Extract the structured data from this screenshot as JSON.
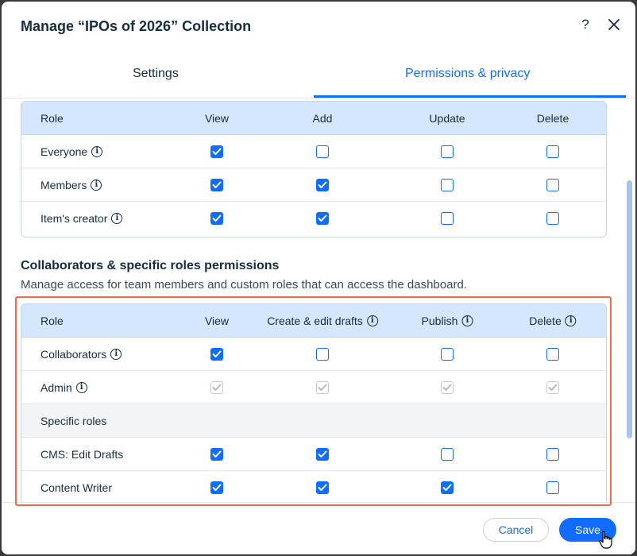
{
  "dialog": {
    "title": "Manage “IPOs of 2026” Collection",
    "help_label": "?",
    "close_label": "close"
  },
  "tabs": [
    {
      "label": "Settings",
      "active": false
    },
    {
      "label": "Permissions & privacy",
      "active": true
    }
  ],
  "general_table": {
    "headers": [
      "Role",
      "View",
      "Add",
      "Update",
      "Delete"
    ],
    "rows": [
      {
        "role": "Everyone",
        "info": true,
        "view": "checked",
        "add": "unchecked",
        "update": "unchecked",
        "delete": "unchecked"
      },
      {
        "role": "Members",
        "info": true,
        "view": "checked",
        "add": "checked",
        "update": "unchecked",
        "delete": "unchecked"
      },
      {
        "role": "Item's creator",
        "info": true,
        "view": "checked",
        "add": "checked",
        "update": "unchecked",
        "delete": "unchecked"
      }
    ]
  },
  "collaborators_section": {
    "title": "Collaborators & specific roles permissions",
    "description": "Manage access for team members and custom roles that can access the dashboard."
  },
  "collab_table": {
    "headers": [
      "Role",
      "View",
      "Create & edit drafts",
      "Publish",
      "Delete"
    ],
    "rows": [
      {
        "role": "Collaborators",
        "info": true,
        "view": "checked",
        "create": "unchecked",
        "publish": "unchecked",
        "delete": "unchecked"
      },
      {
        "role": "Admin",
        "info": true,
        "view": "disabled-checked",
        "create": "disabled-checked",
        "publish": "disabled-checked",
        "delete": "disabled-checked"
      },
      {
        "section": "Specific roles"
      },
      {
        "role": "CMS: Edit Drafts",
        "info": false,
        "view": "checked",
        "create": "checked",
        "publish": "unchecked",
        "delete": "unchecked"
      },
      {
        "role": "Content Writer",
        "info": false,
        "view": "checked",
        "create": "checked",
        "publish": "checked",
        "delete": "unchecked"
      }
    ]
  },
  "footer": {
    "cancel_label": "Cancel",
    "save_label": "Save"
  },
  "colors": {
    "accent": "#116dff",
    "header_bg": "#d5e6ff",
    "highlight": "#f26b4a"
  }
}
